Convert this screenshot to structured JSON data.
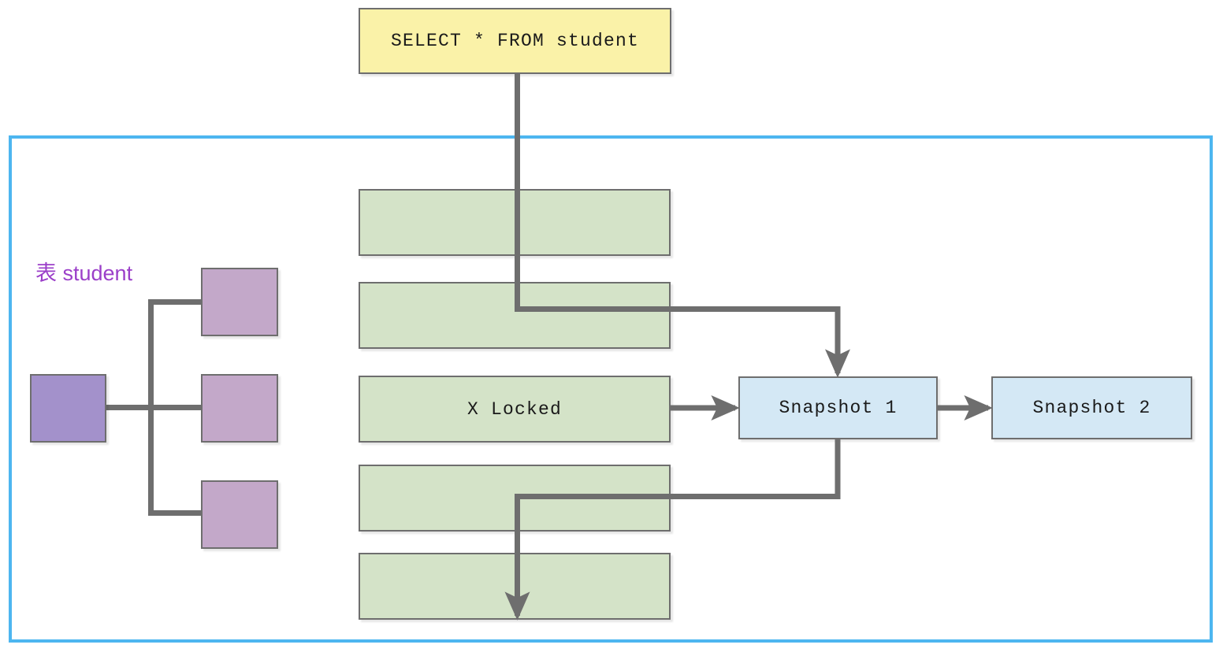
{
  "diagram": {
    "title_box": {
      "label": "SELECT * FROM student",
      "color": "#FAF2A8"
    },
    "container": {
      "border_color": "#4DB6F0"
    },
    "table_label": {
      "text": "表 student",
      "color": "#9B3FC9"
    },
    "tree": {
      "root": {
        "name": "root-node",
        "color": "#A391CB"
      },
      "children": [
        {
          "name": "child-node-1",
          "color": "#C3A8C9"
        },
        {
          "name": "child-node-2",
          "color": "#C3A8C9"
        },
        {
          "name": "child-node-3",
          "color": "#C3A8C9"
        }
      ]
    },
    "rows": [
      {
        "label": "",
        "color": "#D4E3C8"
      },
      {
        "label": "",
        "color": "#D4E3C8"
      },
      {
        "label": "X Locked",
        "color": "#D4E3C8"
      },
      {
        "label": "",
        "color": "#D4E3C8"
      },
      {
        "label": "",
        "color": "#D4E3C8"
      }
    ],
    "snapshots": [
      {
        "label": "Snapshot 1",
        "color": "#D4E8F5"
      },
      {
        "label": "Snapshot 2",
        "color": "#D4E8F5"
      }
    ],
    "connector_color": "#6E6E6E"
  }
}
